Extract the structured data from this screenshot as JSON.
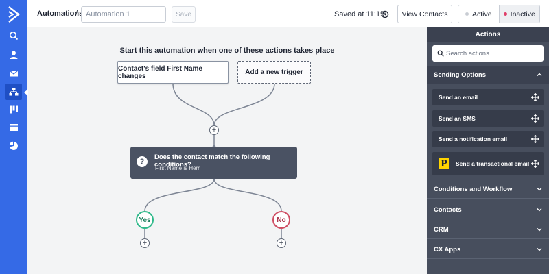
{
  "header": {
    "breadcrumb": "Automations",
    "separator": "/",
    "name_placeholder": "Automation 1",
    "save_label": "Save",
    "saved_text": "Saved at 11:19",
    "view_contacts_label": "View Contacts",
    "status_active_label": "Active",
    "status_inactive_label": "Inactive",
    "status_selected": "Inactive"
  },
  "nav": {
    "items": [
      "search-icon",
      "contacts-icon",
      "email-icon",
      "automations-icon",
      "pipelines-icon",
      "site-icon",
      "reports-icon"
    ],
    "active": "automations-icon"
  },
  "canvas": {
    "heading": "Start this automation when one of these actions takes place",
    "triggers": [
      "Contact's field First Name changes",
      "Add a new trigger"
    ],
    "plus_symbol": "+",
    "condition": {
      "icon": "?",
      "title": "Does the contact match the following conditions?",
      "subtitle": "First Name is Herr"
    },
    "branches": {
      "yes": "Yes",
      "no": "No"
    }
  },
  "panel": {
    "title": "Actions",
    "search_placeholder": "Search actions...",
    "sections": [
      {
        "label": "Sending Options",
        "expanded": true,
        "items": [
          "Send an email",
          "Send an SMS",
          "Send a notification email",
          "Send a transactional email"
        ]
      },
      {
        "label": "Conditions and Workflow",
        "expanded": false
      },
      {
        "label": "Contacts",
        "expanded": false
      },
      {
        "label": "CRM",
        "expanded": false
      },
      {
        "label": "CX Apps",
        "expanded": false
      }
    ],
    "transactional_badge": "P"
  },
  "colors": {
    "nav_bg": "#356ae6",
    "panel_bg": "#474e5d",
    "condition_bg": "#4a5263",
    "yes": "#2fb98a",
    "no": "#cf4d63",
    "inactive_dot": "#e0406a",
    "active_dot": "#c8ccd3"
  }
}
